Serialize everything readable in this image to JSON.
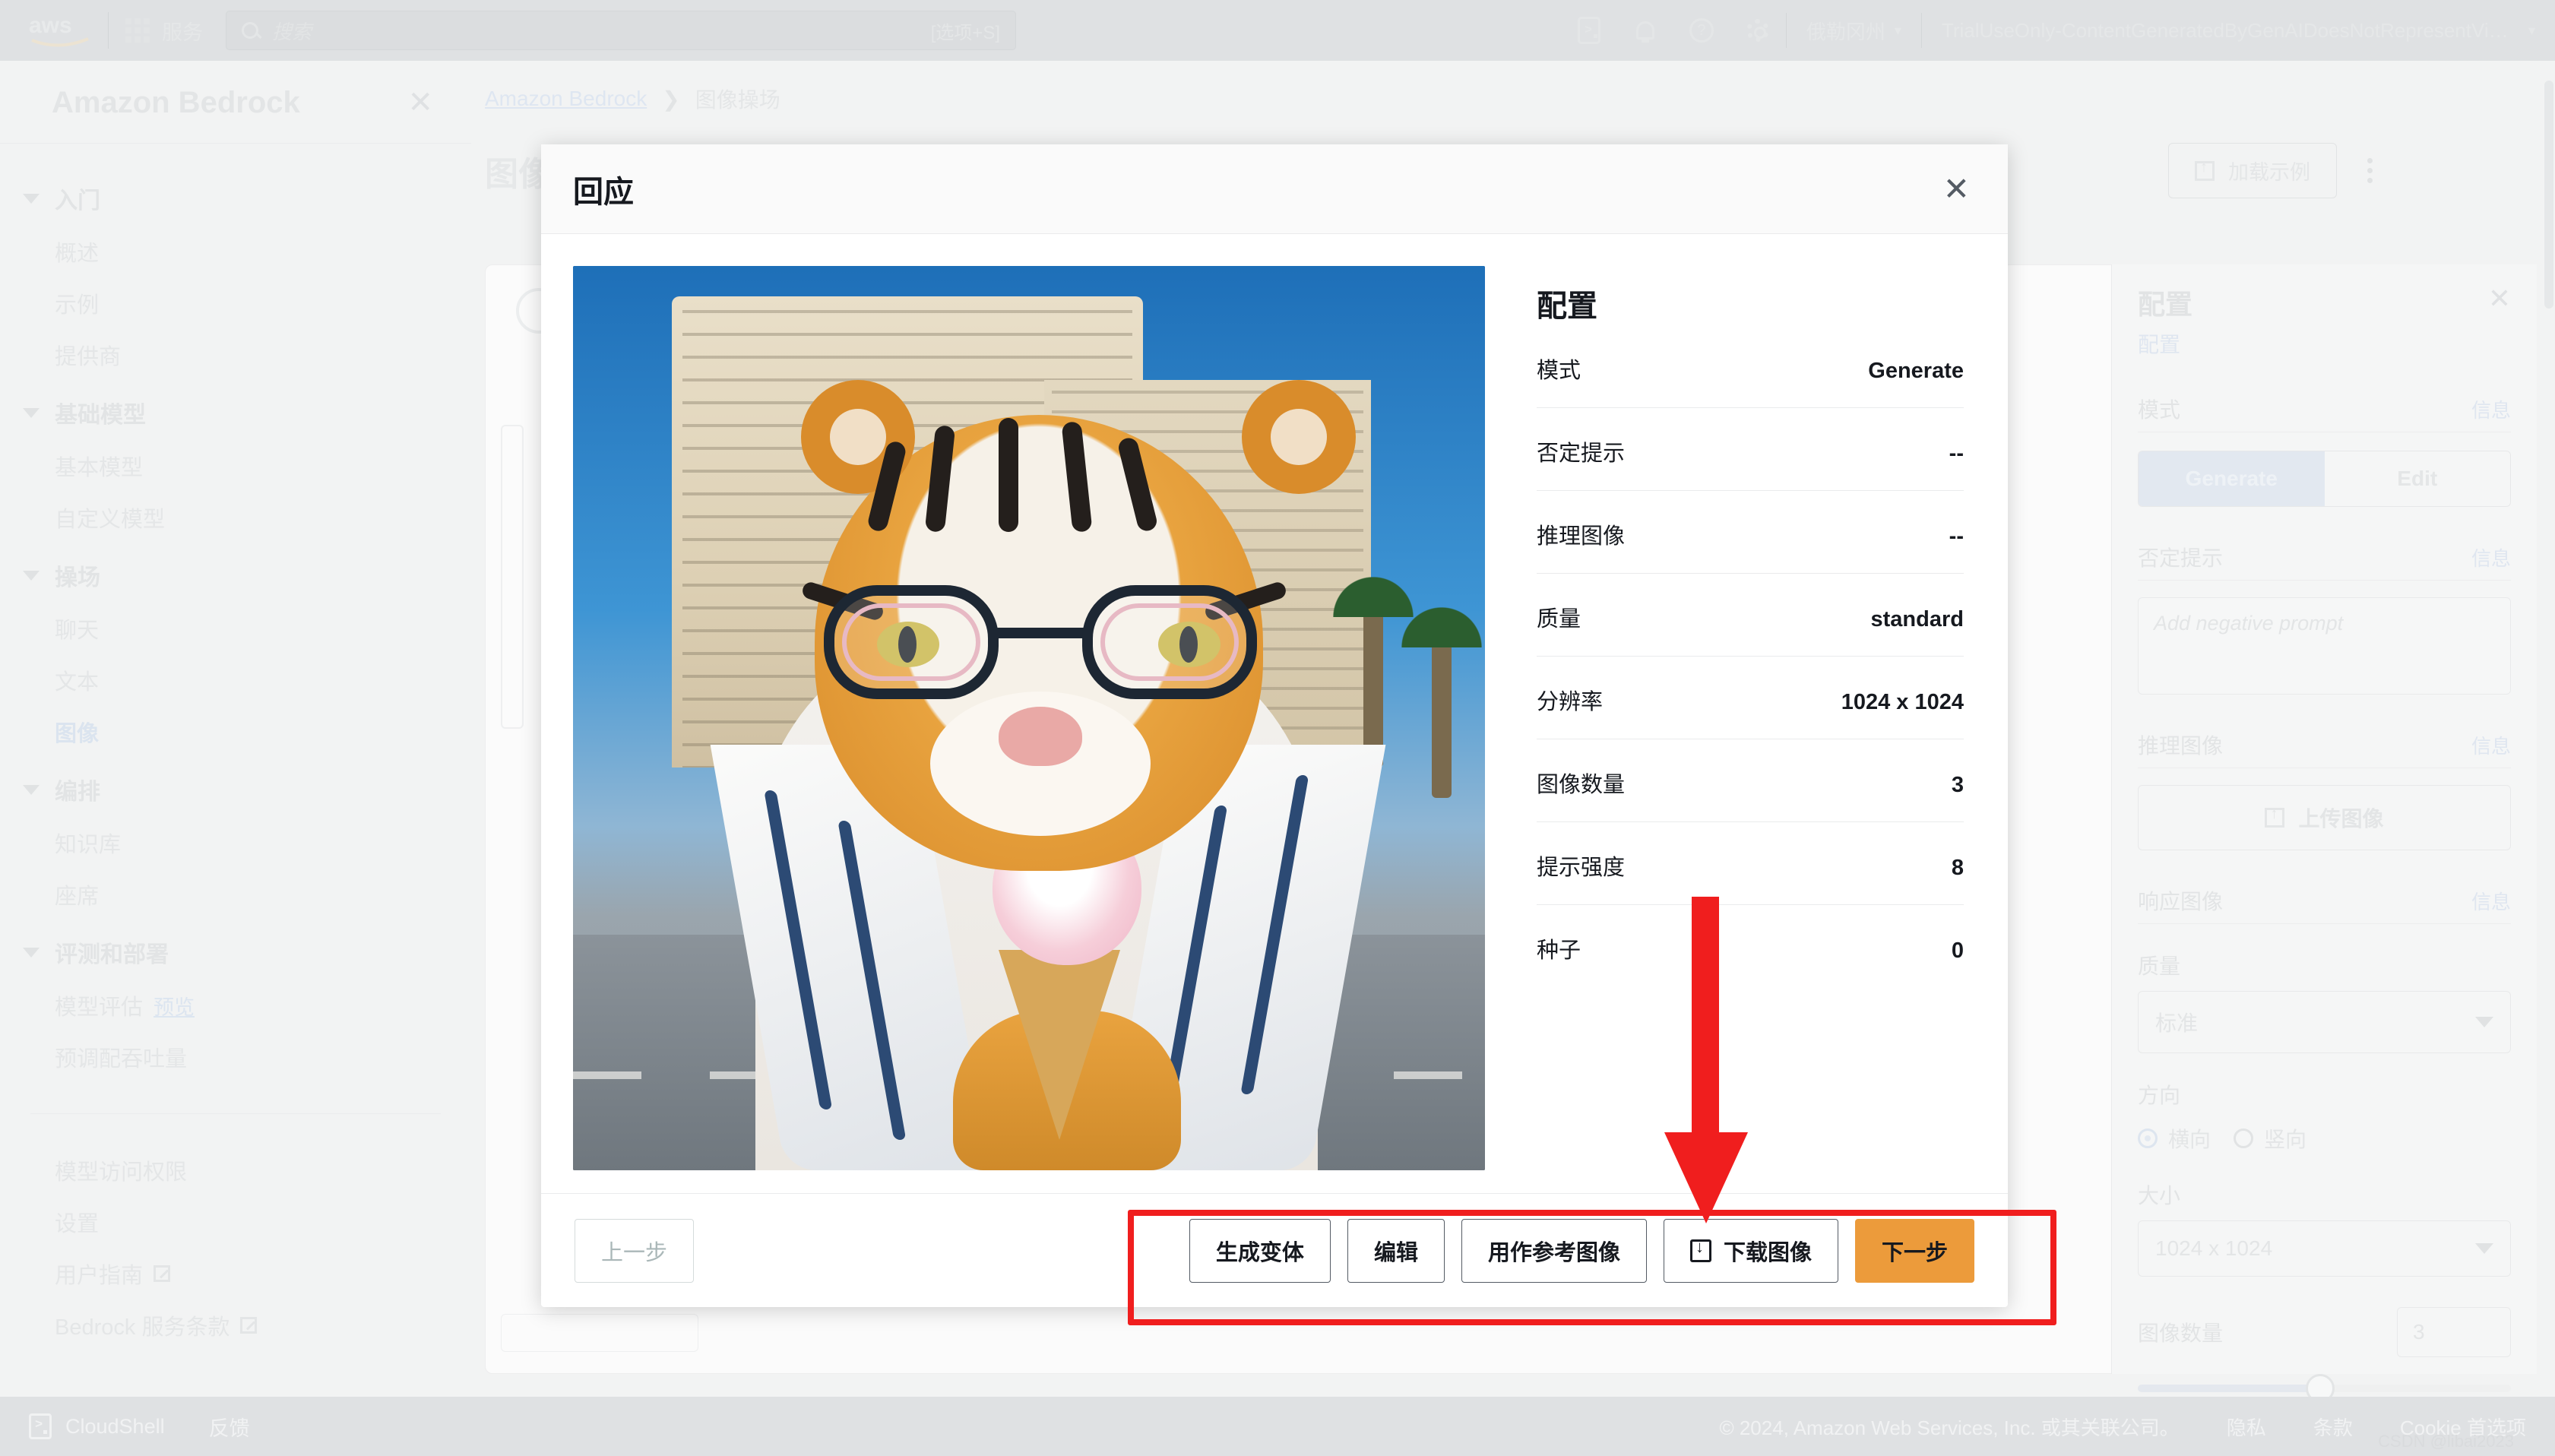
{
  "topnav": {
    "logo": "aws-logo",
    "services_label": "服务",
    "search": {
      "placeholder": "搜索",
      "shortcut": "[选项+S]"
    },
    "icons": [
      "cloudshell-icon",
      "bell-icon",
      "help-icon",
      "settings-icon"
    ],
    "region": "俄勒冈州",
    "account": "TrialUseOnly-ContentGeneratedByGenAIDoesNotRepresentViewsOfAW..."
  },
  "sidebar": {
    "title": "Amazon Bedrock",
    "groups": [
      {
        "label": "入门",
        "items": [
          {
            "label": "概述"
          },
          {
            "label": "示例"
          },
          {
            "label": "提供商"
          }
        ]
      },
      {
        "label": "基础模型",
        "items": [
          {
            "label": "基本模型"
          },
          {
            "label": "自定义模型"
          }
        ]
      },
      {
        "label": "操场",
        "items": [
          {
            "label": "聊天"
          },
          {
            "label": "文本"
          },
          {
            "label": "图像",
            "active": true
          }
        ]
      },
      {
        "label": "编排",
        "items": [
          {
            "label": "知识库"
          },
          {
            "label": "座席"
          }
        ]
      },
      {
        "label": "评测和部署",
        "items": [
          {
            "label": "模型评估",
            "badge": "预览"
          },
          {
            "label": "预调配吞吐量"
          }
        ]
      }
    ],
    "footer_links": [
      {
        "label": "模型访问权限"
      },
      {
        "label": "设置"
      },
      {
        "label": "用户指南",
        "external": true
      },
      {
        "label": "Bedrock 服务条款",
        "external": true
      }
    ]
  },
  "main": {
    "breadcrumb": {
      "root": "Amazon Bedrock",
      "separator": "❯",
      "current": "图像操场"
    },
    "page_title": "图像",
    "load_example_label": "加载示例",
    "more_menu": "kebab-menu-icon"
  },
  "right_panel": {
    "title": "配置",
    "subtitle": "配置",
    "close": "close-icon",
    "mode_label": "模式",
    "info_label": "信息",
    "mode_options": [
      "Generate",
      "Edit"
    ],
    "mode_selected": "Generate",
    "negative_prompt_label": "否定提示",
    "negative_prompt_placeholder": "Add negative prompt",
    "reference_image_label": "推理图像",
    "upload_label": "上传图像",
    "response_image_label": "响应图像",
    "quality_label": "质量",
    "quality_value": "标准",
    "orientation_label": "方向",
    "orientation_options": [
      "横向",
      "竖向"
    ],
    "orientation_selected": "横向",
    "size_label": "大小",
    "size_value": "1024 x 1024",
    "image_count_label": "图像数量",
    "image_count_value": "3"
  },
  "modal": {
    "title": "回应",
    "close": "close-icon",
    "config": {
      "heading": "配置",
      "rows": [
        {
          "key": "模式",
          "value": "Generate"
        },
        {
          "key": "否定提示",
          "value": "--"
        },
        {
          "key": "推理图像",
          "value": "--"
        },
        {
          "key": "质量",
          "value": "standard"
        },
        {
          "key": "分辨率",
          "value": "1024 x 1024"
        },
        {
          "key": "图像数量",
          "value": "3"
        },
        {
          "key": "提示强度",
          "value": "8"
        },
        {
          "key": "种子",
          "value": "0"
        }
      ]
    },
    "footer": {
      "prev_label": "上一步",
      "actions": [
        {
          "label": "生成变体"
        },
        {
          "label": "编辑"
        },
        {
          "label": "用作参考图像"
        },
        {
          "label": "下载图像",
          "icon": "download-icon"
        }
      ],
      "next_label": "下一步"
    }
  },
  "annotations": {
    "arrow": "red-arrow-pointing-down",
    "highlight": "red-rectangle-around-action-buttons"
  },
  "footer": {
    "cloudshell": "CloudShell",
    "feedback": "反馈",
    "copyright": "© 2024, Amazon Web Services, Inc. 或其关联公司。",
    "links": [
      "隐私",
      "条款",
      "Cookie 首选项"
    ],
    "watermark": "CSDN @libai2023"
  },
  "colors": {
    "accent_orange": "#ec9b3b",
    "highlight_red": "#f01e1e",
    "nav_bg": "#dfe1e3",
    "page_bg": "#f2f3f3"
  }
}
